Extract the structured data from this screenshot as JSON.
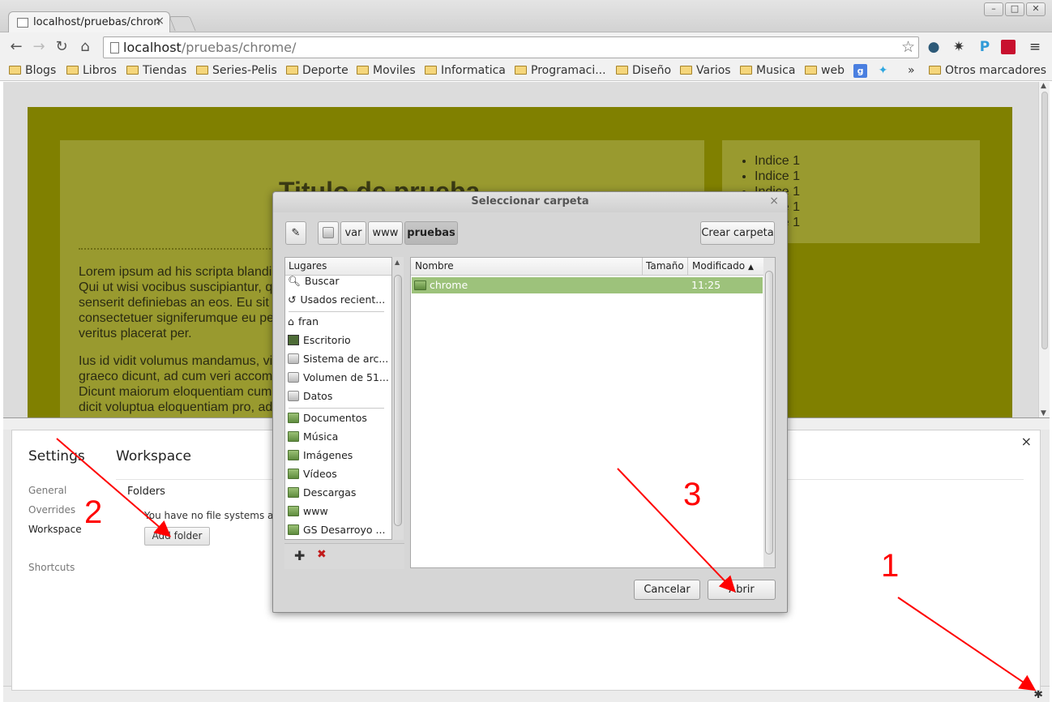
{
  "browser": {
    "tab_title": "localhost/pruebas/chron",
    "url_host": "localhost",
    "url_path": "/pruebas/chrome/",
    "bookmarks": [
      "Blogs",
      "Libros",
      "Tiendas",
      "Series-Pelis",
      "Deporte",
      "Moviles",
      "Informatica",
      "Programaci...",
      "Diseño",
      "Varios",
      "Musica",
      "web"
    ],
    "bookmark_overflow": "»",
    "other_bookmarks": "Otros marcadores"
  },
  "page": {
    "title": "Titulo de prueba",
    "paragraph1": "Lorem ipsum ad his scripta blandi\nQui ut wisi vocibus suscipiantur, q\nsenserit definiebas an eos. Eu sit\nconsectetuer signiferumque eu pe\nveritus placerat per.",
    "paragraph2": "Ius id vidit volumus mandamus, vi\ngraeco dicunt, ad cum veri accom\nDicunt maiorum eloquentiam cum\ndicit voluptua eloquentiam pro, ad",
    "index_items": [
      "Indice 1",
      "Indice 1",
      "Indice 1",
      "Indice 1",
      "Indice 1"
    ]
  },
  "settings": {
    "title": "Settings",
    "section_title": "Workspace",
    "nav": [
      "General",
      "Overrides",
      "Workspace",
      "Shortcuts"
    ],
    "folders_heading": "Folders",
    "no_fs_text": "You have no file systems adde",
    "add_folder_label": "Add folder"
  },
  "dialog": {
    "title": "Seleccionar carpeta",
    "path_buttons": [
      "var",
      "www",
      "pruebas"
    ],
    "create_folder": "Crear carpeta",
    "places_header": "Lugares",
    "places": [
      "Buscar",
      "Usados recient...",
      "fran",
      "Escritorio",
      "Sistema de arc...",
      "Volumen de 51...",
      "Datos",
      "Documentos",
      "Música",
      "Imágenes",
      "Vídeos",
      "Descargas",
      "www",
      "GS Desarroyo ..."
    ],
    "columns": {
      "name": "Nombre",
      "size": "Tamaño",
      "modified": "Modificado"
    },
    "files": [
      {
        "name": "chrome",
        "modified": "11:25"
      }
    ],
    "cancel_label": "Cancelar",
    "open_label": "Abrir"
  },
  "annotations": [
    "1",
    "2",
    "3"
  ],
  "colors": {
    "annotation": "#ff0000",
    "selection": "#9dc27b",
    "page_bg": "#808000"
  }
}
